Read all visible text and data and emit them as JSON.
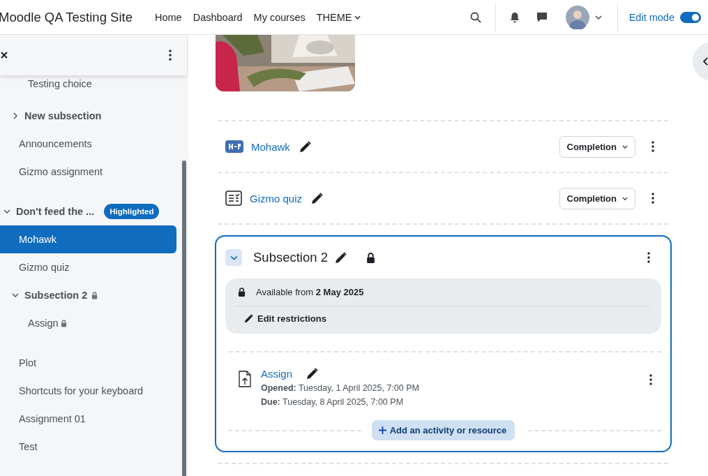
{
  "navbar": {
    "site_name": "Moodle QA Testing Site",
    "links": [
      {
        "label": "Home",
        "dropdown": false
      },
      {
        "label": "Dashboard",
        "dropdown": false
      },
      {
        "label": "My courses",
        "dropdown": false
      },
      {
        "label": "THEME",
        "dropdown": true
      }
    ],
    "edit_mode": {
      "label": "Edit mode",
      "on": true
    }
  },
  "sidebar": {
    "items": [
      {
        "kind": "subsection_tail",
        "children": [
          {
            "kind": "activity",
            "label": "Testing choice",
            "selected": false,
            "locked": false
          }
        ]
      },
      {
        "kind": "subsection",
        "label": "New subsection",
        "expanded": false,
        "locked": false
      },
      {
        "kind": "activity",
        "label": "Announcements",
        "selected": false,
        "locked": false
      },
      {
        "kind": "activity",
        "label": "Gizmo assignment",
        "selected": false,
        "locked": false
      },
      {
        "kind": "section",
        "label": "Don't feed the ...",
        "badge": "Highlighted",
        "expanded": true,
        "children": [
          {
            "kind": "activity",
            "label": "Mohawk",
            "selected": true,
            "locked": false
          },
          {
            "kind": "activity",
            "label": "Gizmo quiz",
            "selected": false,
            "locked": false
          },
          {
            "kind": "subsection",
            "label": "Subsection 2",
            "expanded": true,
            "locked": true,
            "children": [
              {
                "kind": "activity",
                "label": "Assign",
                "selected": false,
                "locked": true
              }
            ]
          },
          {
            "kind": "activity",
            "label": "Plot",
            "selected": false,
            "locked": false
          },
          {
            "kind": "activity",
            "label": "Shortcuts for your keyboard",
            "selected": false,
            "locked": false
          },
          {
            "kind": "activity",
            "label": "Assignment 01",
            "selected": false,
            "locked": false
          },
          {
            "kind": "activity",
            "label": "Test",
            "selected": false,
            "locked": false
          }
        ]
      }
    ]
  },
  "course": {
    "activities": [
      {
        "kind": "h5p",
        "name": "Mohawk",
        "completion": "Completion"
      },
      {
        "kind": "quiz",
        "name": "Gizmo quiz",
        "completion": "Completion"
      }
    ],
    "subsection": {
      "title": "Subsection 2",
      "expanded": true,
      "locked": true,
      "restriction": {
        "text": "Available from **2 May 2025**",
        "edit": "Edit restrictions"
      },
      "activities": [
        {
          "kind": "assign",
          "name": "Assign",
          "dates": [
            "**Opened:** Tuesday, 1 April 2025, 7:00 PM",
            "**Due:** Tuesday, 8 April 2025, 7:00 PM"
          ]
        }
      ],
      "add_button": "Add an activity or resource"
    }
  }
}
